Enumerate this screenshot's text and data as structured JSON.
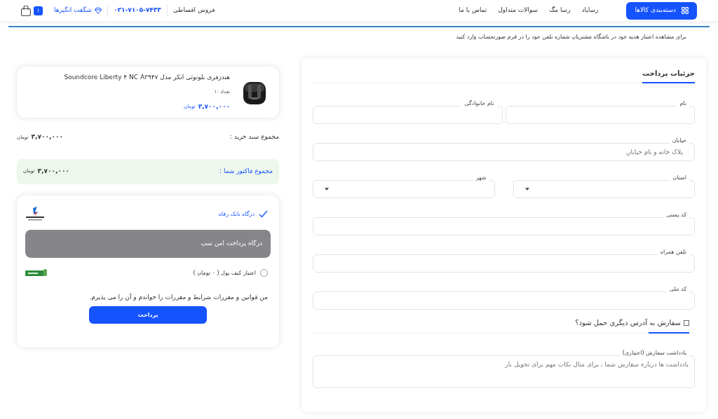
{
  "header": {
    "category_button": "دسته‌بندی کالاها",
    "nav": [
      "رساپاد",
      "رسا مگ",
      "سوالات متداول",
      "تماس با ما"
    ],
    "installment": "فروش اقساطی",
    "phone": "۰۲۱-۷۱۰۵-۷۴۳۳",
    "amazing": "شگفت انگیزها",
    "cart_count": "۱"
  },
  "notice": "برای مشاهده اعتبار هدیه خود در باشگاه مشتریان شماره تلفن خود را در فرم صورتحساب وارد کنید",
  "billing": {
    "title": "جزئیات پرداخت",
    "rows": [
      {
        "fields": [
          {
            "kind": "text",
            "label": "نام"
          },
          {
            "kind": "text",
            "label": "نام خانوادگی"
          }
        ]
      },
      {
        "fields": [
          {
            "kind": "text",
            "label": "خیابان",
            "placeholder": "پلاک خانه و نام خیابان"
          }
        ]
      },
      {
        "fields": [
          {
            "kind": "select",
            "label": "استان"
          },
          {
            "kind": "select",
            "label": "شهر"
          }
        ]
      },
      {
        "fields": [
          {
            "kind": "text",
            "label": "کد پستی"
          }
        ]
      },
      {
        "fields": [
          {
            "kind": "text",
            "label": "تلفن همراه"
          }
        ]
      },
      {
        "fields": [
          {
            "kind": "text",
            "label": "کد ملی"
          }
        ]
      }
    ],
    "ship_elsewhere": {
      "label": "سفارش به آدرس دیگری حمل شود؟",
      "checked": false
    },
    "notes": {
      "label": "یادداشت سفارش (اختیاری)",
      "placeholder": "یادداشت ها درباره سفارش شما ، برای مثال نکات مهم برای تحویل بار"
    }
  },
  "order": {
    "product": {
      "title": "هندزفری بلوتوثی انکر مدل Soundcore Liberty ۴ NC A۳۹۴۷",
      "quantity": "تعداد :۱",
      "price": "۳,۷۰۰,۰۰۰",
      "currency": "تومان"
    },
    "subtotal": {
      "label": "مجموع سبد خرید :",
      "amount": "۳,۷۰۰,۰۰۰",
      "currency": "تومان"
    },
    "total": {
      "label": "مجموع فاکتور شما :",
      "amount": "۳,۷۰۰,۰۰۰",
      "currency": "تومان"
    },
    "payment": {
      "methods": [
        {
          "kind": "gateway",
          "label": "درگاه بانک رفاه",
          "selected": true,
          "description": "درگاه پرداخت امن سپ"
        },
        {
          "kind": "wallet",
          "label": "اعتبار کیف پول ( ۰ تومان )",
          "selected": false
        }
      ],
      "terms": "من قوانین و مقررات شرایط و مقررات را خواندم و آن را می پذیرم.",
      "pay_button": "پرداخت"
    }
  }
}
